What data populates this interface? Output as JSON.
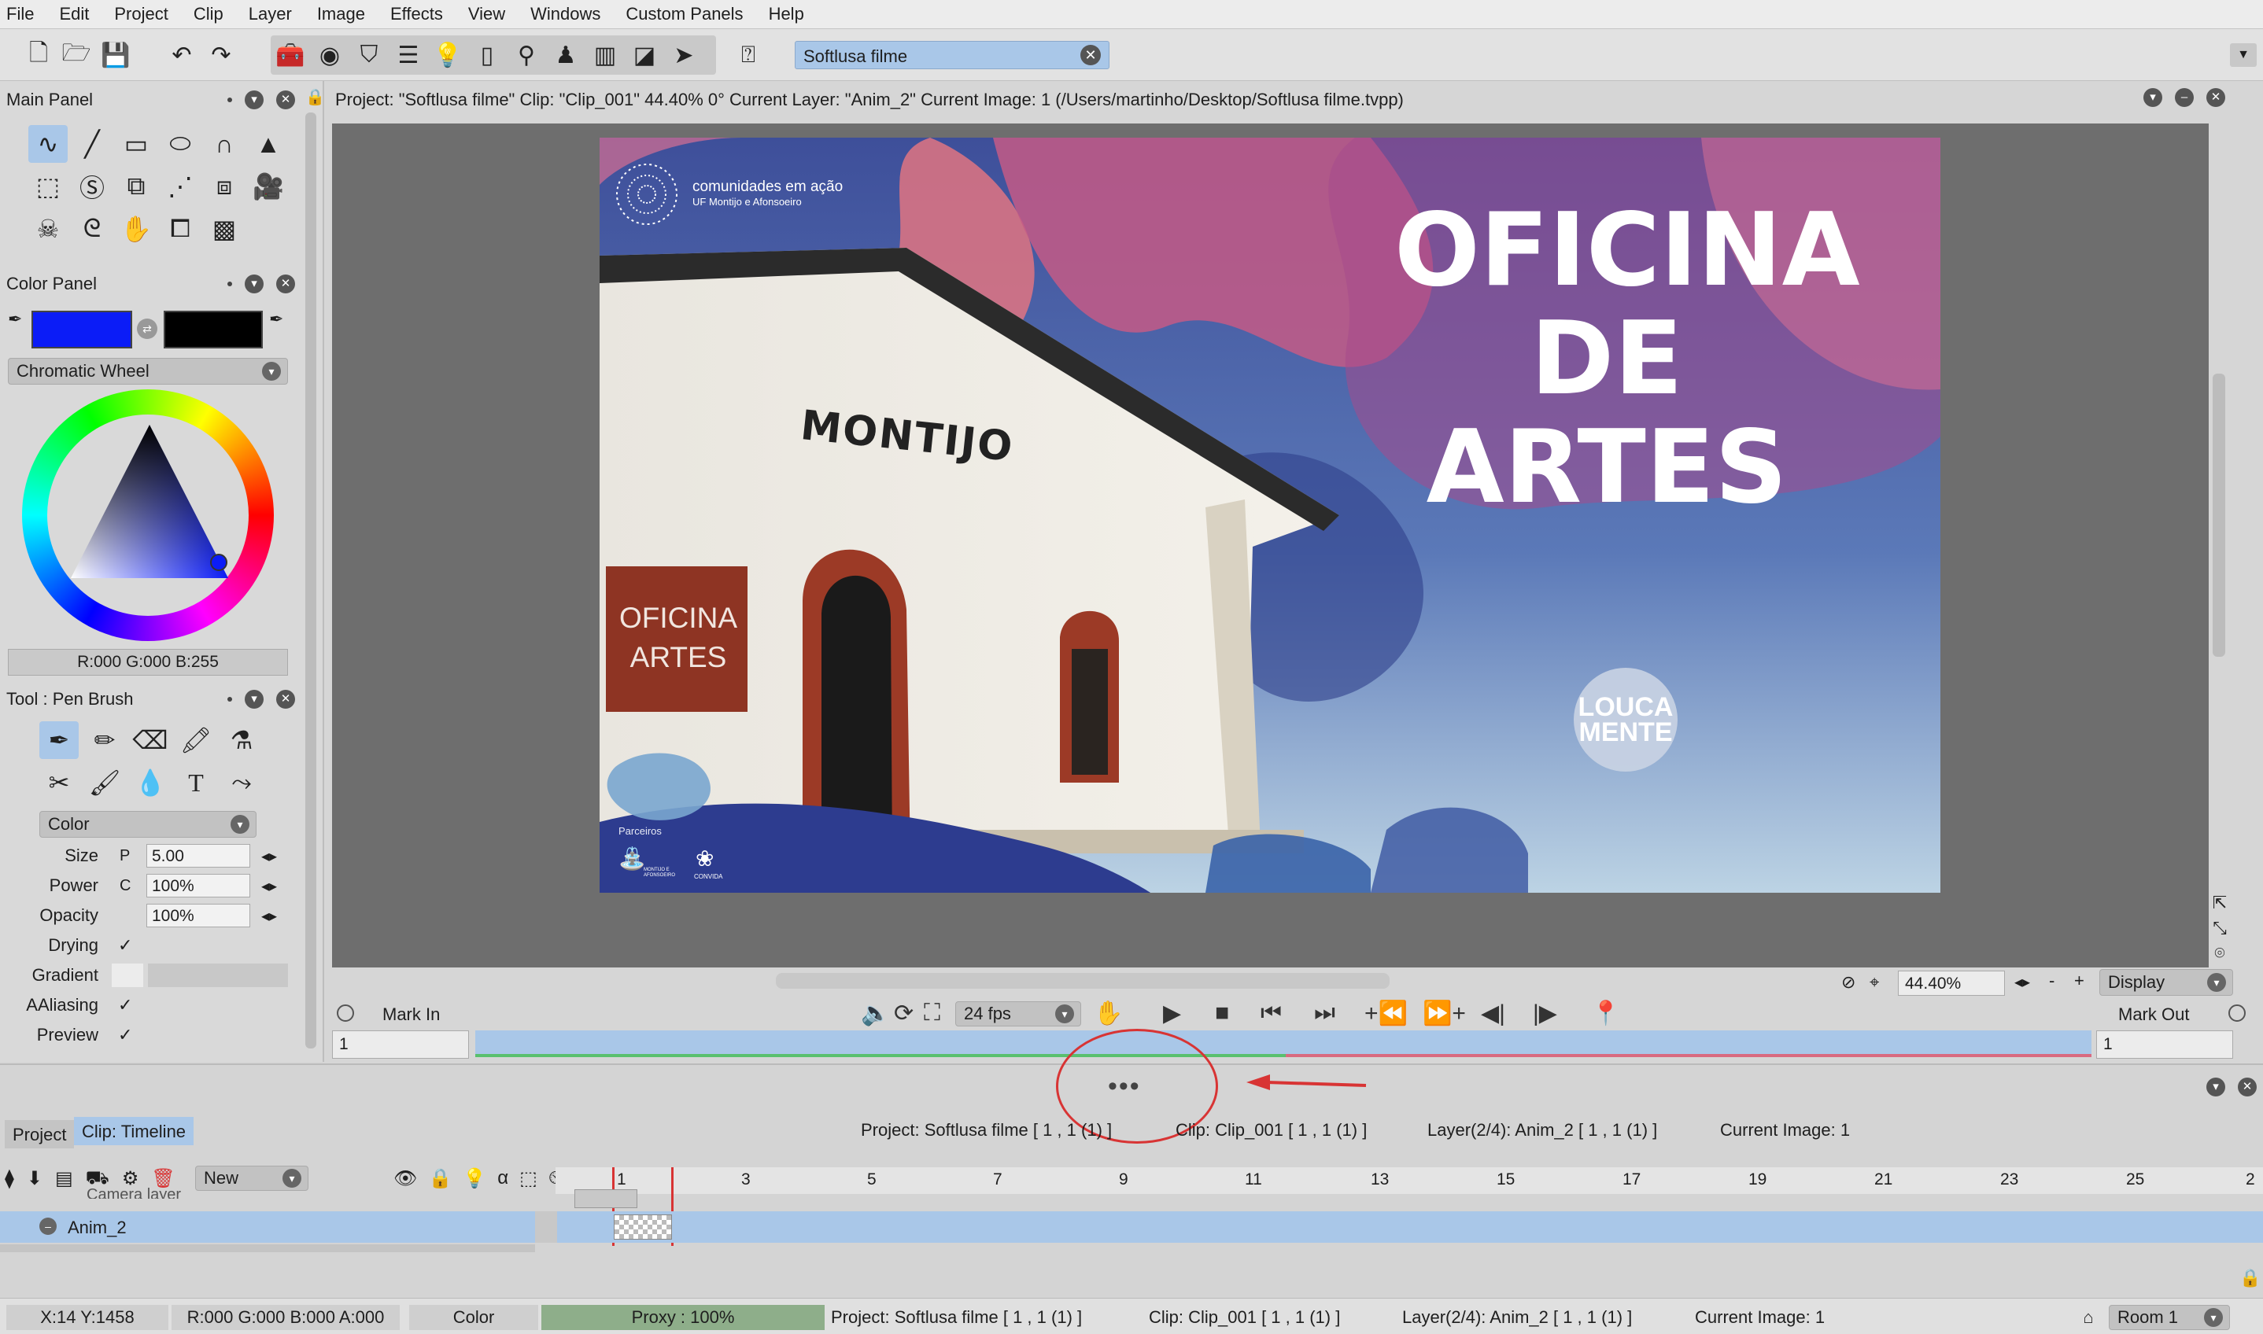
{
  "menu": [
    "File",
    "Edit",
    "Project",
    "Clip",
    "Layer",
    "Image",
    "Effects",
    "View",
    "Windows",
    "Custom Panels",
    "Help"
  ],
  "toolbar": {
    "search_value": "Softlusa filme"
  },
  "main_panel": {
    "title": "Main Panel"
  },
  "color_panel": {
    "title": "Color Panel",
    "mode": "Chromatic Wheel",
    "rgb_readout": "R:000 G:000 B:255",
    "primary_color": "#0b1cf7",
    "secondary_color": "#000000"
  },
  "tool_panel": {
    "title": "Tool : Pen Brush",
    "mode": "Color",
    "props": [
      {
        "label": "Size",
        "prefix": "P",
        "value": "5.00"
      },
      {
        "label": "Power",
        "prefix": "C",
        "value": "100%"
      },
      {
        "label": "Opacity",
        "prefix": "",
        "value": "100%"
      }
    ],
    "checks": [
      {
        "label": "Drying",
        "mark": "✓"
      },
      {
        "label": "Gradient",
        "mark": ""
      },
      {
        "label": "AAliasing",
        "mark": "✓"
      },
      {
        "label": "Preview",
        "mark": "✓"
      }
    ]
  },
  "view": {
    "info": "Project: \"Softlusa filme\"  Clip: \"Clip_001\"   44.40%   0°  Current Layer: \"Anim_2\"  Current Image: 1 (/Users/martinho/Desktop/Softlusa filme.tvpp)",
    "zoom": "44.40%",
    "display": "Display"
  },
  "artwork": {
    "org_line1": "comunidades em ação",
    "org_line2": "UF Montijo e Afonsoeiro",
    "building_sign": "MONTIJO",
    "plaque_line1": "OFICINA",
    "plaque_line2": "ARTES",
    "title_line1": "OFICINA",
    "title_line2": "DE",
    "title_line3": "ARTES",
    "logo_line1": "LOUCA",
    "logo_line2": "MENTE",
    "partners": "Parceiros",
    "partner_org_1": "MONTIJO E AFONSOEIRO",
    "partner_org_2": "CONVIDA"
  },
  "transport": {
    "mark_in": "Mark In",
    "mark_out": "Mark Out",
    "fps": "24 fps",
    "in_frame": "1",
    "out_frame": "1"
  },
  "annotation": {
    "dots": "•••"
  },
  "bottom": {
    "tabs": [
      "Project",
      "Clip: Timeline"
    ],
    "summary": [
      "Project: Softlusa filme [ 1 , 1  (1) ]",
      "Clip: Clip_001 [ 1 , 1  (1) ]",
      "Layer(2/4): Anim_2 [ 1 , 1  (1) ]",
      "Current Image: 1"
    ],
    "new_label": "New",
    "layers": [
      "Camera layer",
      "Anim_2"
    ],
    "ruler": [
      "1",
      "3",
      "5",
      "7",
      "9",
      "11",
      "13",
      "15",
      "17",
      "19",
      "21",
      "23",
      "25",
      "2"
    ]
  },
  "status": {
    "coords": "X:14  Y:1458",
    "color_val": "R:000 G:000 B:000 A:000",
    "mode": "Color",
    "proxy": "Proxy : 100%",
    "project": "Project: Softlusa filme [ 1 , 1  (1) ]",
    "clip": "Clip: Clip_001 [ 1 , 1  (1) ]",
    "layer": "Layer(2/4): Anim_2 [ 1 , 1  (1) ]",
    "image": "Current Image: 1",
    "room": "Room 1"
  }
}
